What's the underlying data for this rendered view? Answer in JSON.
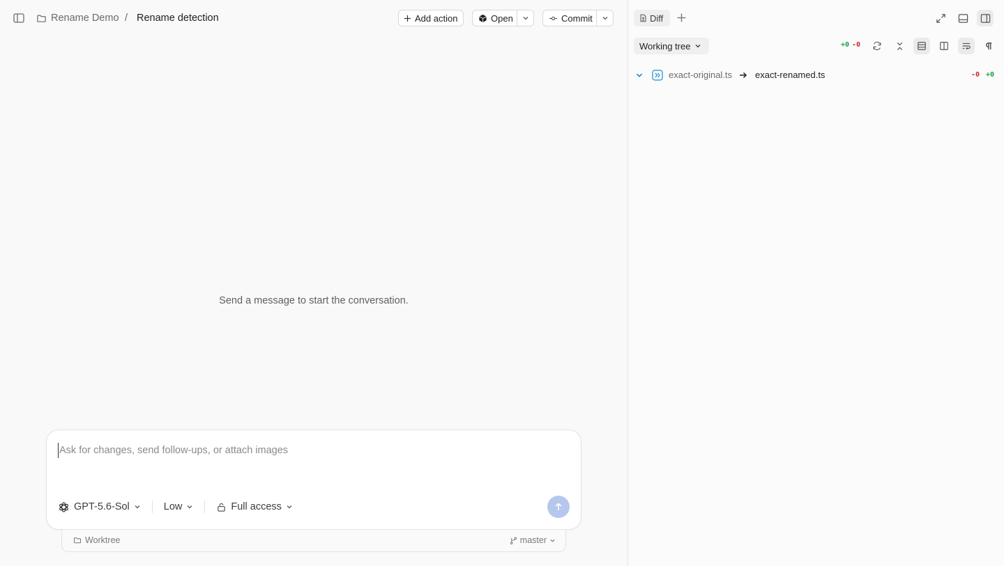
{
  "breadcrumb": {
    "project": "Rename Demo",
    "separator": "/",
    "current": "Rename detection"
  },
  "toolbar": {
    "add_action_label": "Add action",
    "open_label": "Open",
    "commit_label": "Commit"
  },
  "conversation": {
    "empty_message": "Send a message to start the conversation."
  },
  "composer": {
    "placeholder": "Ask for changes, send follow-ups, or attach images",
    "value": "",
    "model": "GPT-5.6-Sol",
    "effort": "Low",
    "access": "Full access"
  },
  "footer": {
    "worktree_label": "Worktree",
    "branch": "master"
  },
  "diff_panel": {
    "tab_label": "Diff",
    "source": "Working tree",
    "added": "+0",
    "removed": "-0",
    "files": [
      {
        "old_name": "exact-original.ts",
        "new_name": "exact-renamed.ts",
        "removed": "-0",
        "added": "+0"
      }
    ]
  },
  "colors": {
    "accent": "#1a8fd6",
    "added": "#1a9d4a",
    "removed": "#d4232c",
    "send": "#b5c7ec"
  },
  "icons": [
    "sidebar-toggle-icon",
    "folder-icon",
    "plus-icon",
    "cube-icon",
    "commit-icon",
    "chevron-down-icon",
    "diff-file-icon",
    "expand-icon",
    "panel-bottom-icon",
    "panel-right-icon",
    "refresh-icon",
    "collapse-icon",
    "unified-view-icon",
    "split-view-icon",
    "wrap-icon",
    "pilcrow-icon",
    "rename-icon",
    "arrow-right-icon",
    "openai-icon",
    "lock-icon",
    "arrow-up-icon",
    "git-branch-icon"
  ]
}
